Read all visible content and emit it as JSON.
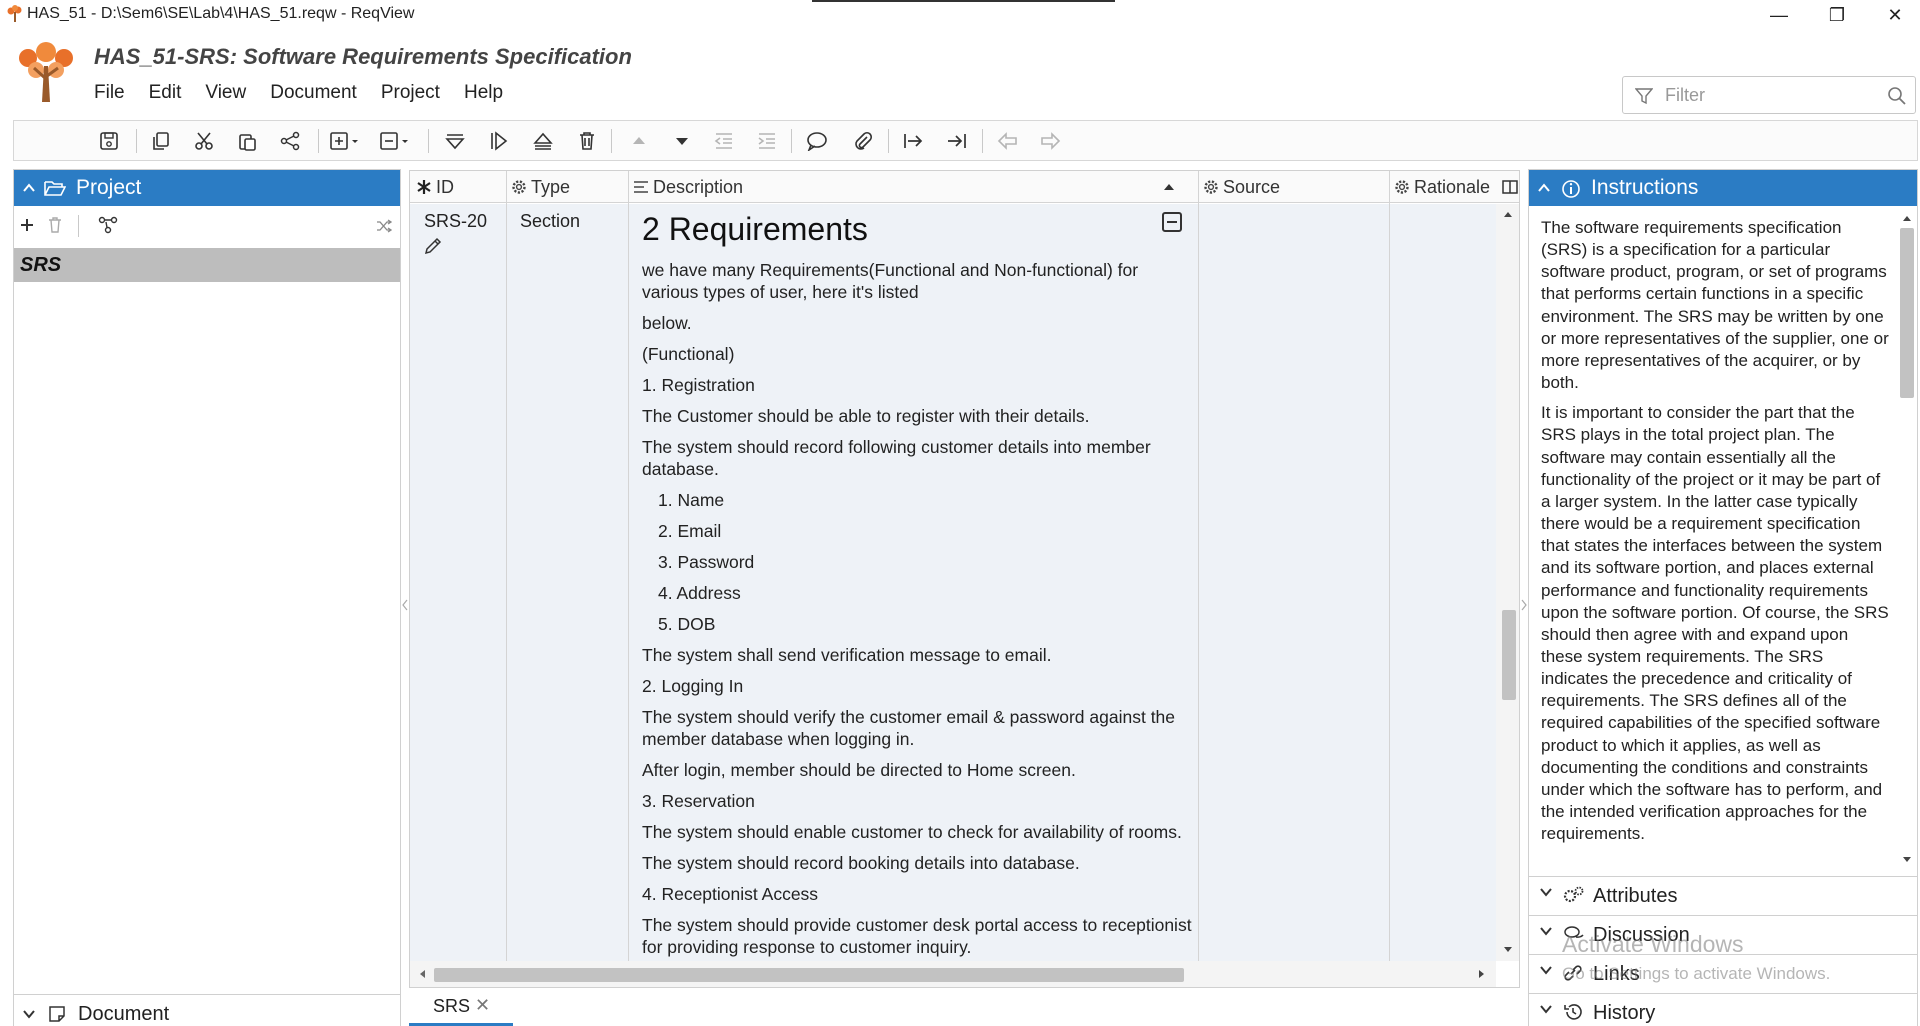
{
  "window": {
    "title": "HAS_51 - D:\\Sem6\\SE\\Lab\\4\\HAS_51.reqw - ReqView",
    "minimize": "—",
    "restore": "❐",
    "close": "✕"
  },
  "header": {
    "document_title": "HAS_51-SRS: Software Requirements Specification",
    "menu": [
      "File",
      "Edit",
      "View",
      "Document",
      "Project",
      "Help"
    ],
    "filter_placeholder": "Filter"
  },
  "project_panel": {
    "title": "Project",
    "tree_items": [
      "SRS"
    ],
    "document_section": "Document"
  },
  "table": {
    "columns": [
      "ID",
      "Type",
      "Description",
      "Source",
      "Rationale"
    ],
    "row": {
      "id": "SRS-20",
      "type": "Section",
      "heading": "2 Requirements",
      "paragraphs_a": [
        "we have many Requirements(Functional and Non-functional) for various types of user, here it's listed",
        "below.",
        "(Functional)",
        "1. Registration",
        "The Customer should be able to register with their details.",
        "The system should record following customer details into member database."
      ],
      "list": [
        "1. Name",
        "2. Email",
        "3. Password",
        "4. Address",
        "5. DOB"
      ],
      "paragraphs_b": [
        "The system shall send verification message to email.",
        "2. Logging In",
        "The system should verify the customer email & password against the member database when logging in.",
        "After login, member should be directed to Home screen.",
        "3. Reservation",
        "The system should enable customer to check for availability of rooms.",
        "The system should record booking details into database.",
        "4. Receptionist Access",
        "The system should provide customer desk portal access to receptionist for providing response to customer inquiry."
      ]
    }
  },
  "bottom_tabs": [
    {
      "label": "SRS",
      "close": "✕"
    }
  ],
  "instructions_panel": {
    "title": "Instructions",
    "paragraphs": [
      "The software requirements specification (SRS) is a specification for a particular software product, program, or set of programs that performs certain functions in a specific environment. The SRS may be written by one or more representatives of the supplier, one or more representatives of the acquirer, or by both.",
      "It is important to consider the part that the SRS plays in the total project plan. The software may contain essentially all the functionality of the project or it may be part of a larger system. In the latter case typically there would be a requirement specification that states the interfaces between the system and its software portion, and places external performance and functionality requirements upon the software portion. Of course, the SRS should then agree with and expand upon these system requirements. The SRS indicates the precedence and criticality of requirements. The SRS defines all of the required capabilities of the specified software product to which it applies, as well as documenting the conditions and constraints under which the software has to perform, and the intended verification approaches for the requirements."
    ],
    "sections": [
      "Attributes",
      "Discussion",
      "Links",
      "History"
    ]
  },
  "watermark": {
    "line1": "Activate Windows",
    "line2": "Go to Settings to activate Windows."
  },
  "colors": {
    "accent": "#2b7cc4",
    "selected_row": "#bdbdbd",
    "column_bg": "#eef2f7"
  }
}
